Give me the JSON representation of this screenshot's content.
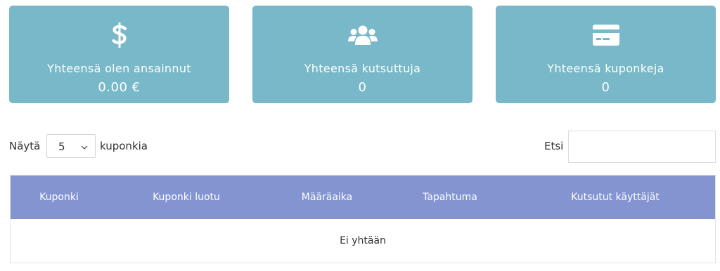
{
  "stats": {
    "earned": {
      "icon": "dollar-icon",
      "label": "Yhteensä olen ansainnut",
      "value": "0.00 €"
    },
    "invited": {
      "icon": "users-icon",
      "label": "Yhteensä kutsuttuja",
      "value": "0"
    },
    "coupons": {
      "icon": "credit-card-icon",
      "label": "Yhteensä kuponkeja",
      "value": "0"
    }
  },
  "controls": {
    "show_label": "Näytä",
    "page_size": "5",
    "after_label": "kuponkia",
    "search_label": "Etsi",
    "search_value": ""
  },
  "table": {
    "headers": [
      "Kuponki",
      "Kuponki luotu",
      "Määräaika",
      "Tapahtuma",
      "Kutsutut käyttäjät"
    ],
    "empty_message": "Ei yhtään"
  },
  "colors": {
    "card_bg": "#78b8c8",
    "table_header_bg": "#8394d1"
  }
}
